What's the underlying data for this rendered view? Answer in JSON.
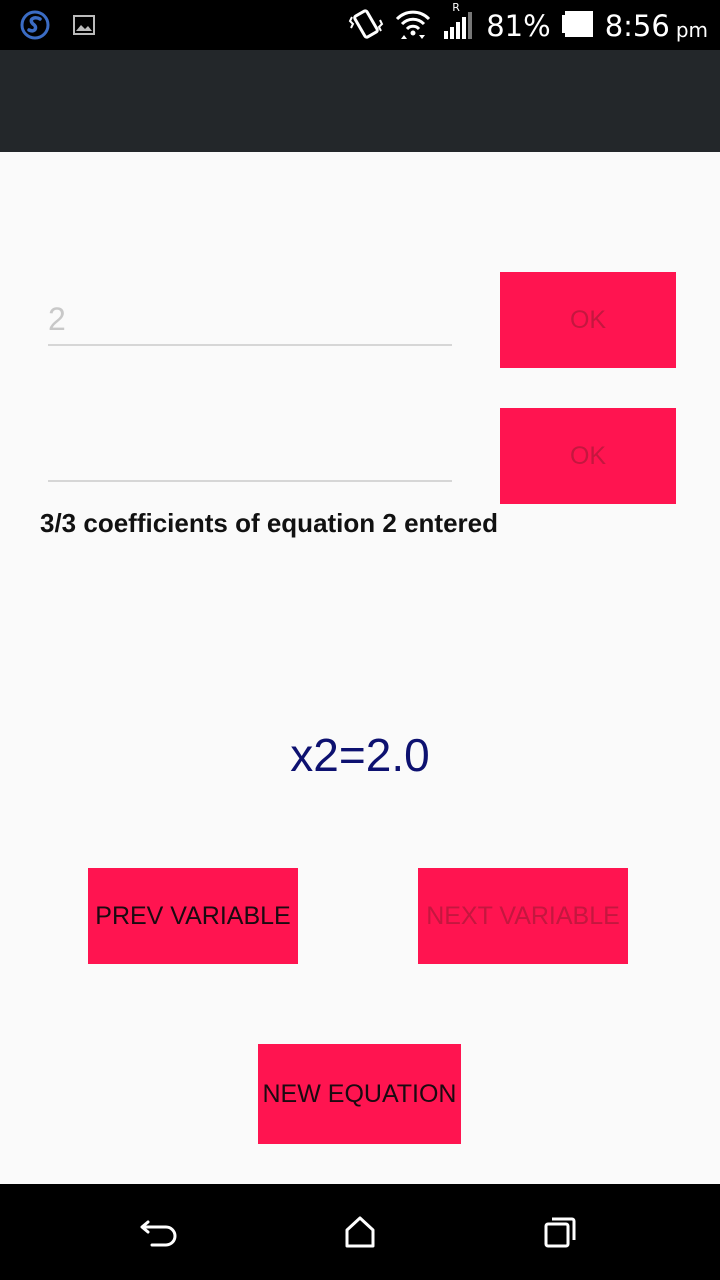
{
  "status_bar": {
    "battery": "81%",
    "time": "8:56",
    "ampm": "pm",
    "network_label": "R"
  },
  "equation_form": {
    "coefficient_input_1": {
      "value": "",
      "placeholder": "2"
    },
    "coefficient_input_2": {
      "value": "",
      "placeholder": ""
    },
    "ok_label_1": "OK",
    "ok_label_2": "OK",
    "status_message": "3/3 coefficients of equation 2 entered"
  },
  "result": {
    "text": "x2=2.0"
  },
  "actions": {
    "prev_variable": "PREV VARIABLE",
    "next_variable": "NEXT VARIABLE",
    "new_equation": "NEW EQUATION"
  },
  "colors": {
    "accent": "#ff1450",
    "app_bar": "#23272a",
    "result_text": "#0d1170",
    "disabled_text": "#c4173f"
  },
  "icons": [
    "app-s-icon",
    "image-notification-icon",
    "vibrate-icon",
    "wifi-icon",
    "signal-icon",
    "battery-icon",
    "back-icon",
    "home-icon",
    "recents-icon"
  ]
}
